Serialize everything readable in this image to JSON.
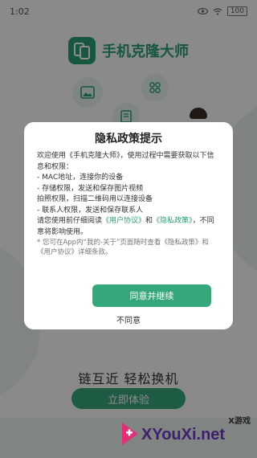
{
  "status_bar": {
    "time": "1:02",
    "battery": "100"
  },
  "app": {
    "title": "手机克隆大师"
  },
  "feature_icons": [
    "image-icon",
    "grid-icon",
    "document-icon"
  ],
  "main": {
    "slogan": "链互近 轻松换机",
    "cta_label": "立即体验"
  },
  "modal": {
    "title": "隐私政策提示",
    "intro": "欢迎使用《手机克隆大师》，使用过程中需要获取以下信息和权限：",
    "items": [
      "- MAC地址，连接你的设备",
      "- 存储权限，发送和保存图片视频",
      "  拍照权限，扫描二维码用以连接设备",
      "- 联系人权限，发送和保存联系人"
    ],
    "read_prefix": "请您使用前仔细阅读",
    "user_agreement_link": "《用户协议》",
    "and": "和",
    "privacy_policy_link": "《隐私政策》",
    "read_suffix": "，不同意将影响使用。",
    "note": "* 您可在App内“我的-关于”页面随时查看《隐私政策》和《用户协议》详细条款。",
    "agree_label": "同意并继续",
    "disagree_label": "不同意"
  },
  "watermark": {
    "tag": "X游戏",
    "text": "XYouXi.net"
  },
  "colors": {
    "accent": "#36a77a",
    "brand": "#2b9e6f",
    "overlay": "rgba(0,0,0,0.45)"
  }
}
